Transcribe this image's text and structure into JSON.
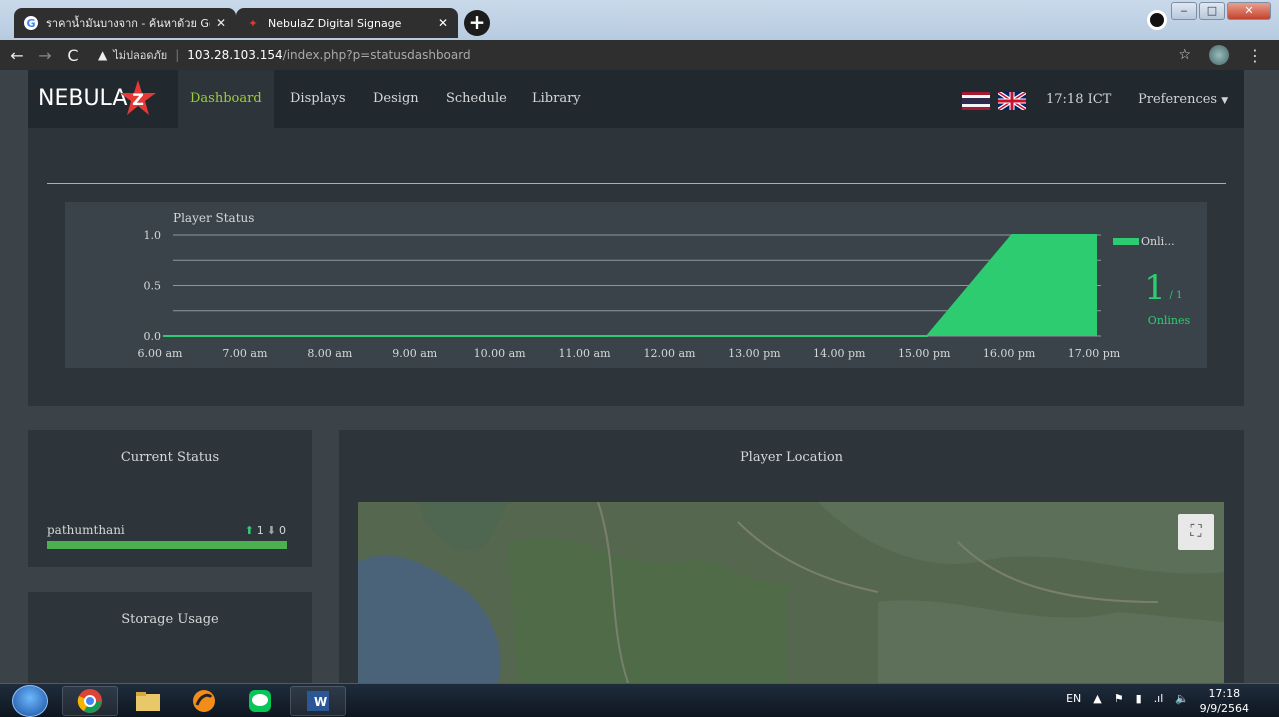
{
  "browser": {
    "tabs": [
      {
        "label": "ราคาน้ำมันบางจาก - ค้นหาด้วย Googl",
        "icon": "google-icon",
        "active": false
      },
      {
        "label": "NebulaZ Digital Signage",
        "icon": "nebulaz-icon",
        "active": true
      }
    ],
    "address": {
      "insecure_label": "ไม่ปลอดภัย",
      "host": "103.28.103.154",
      "path": "/index.php?p=statusdashboard"
    }
  },
  "app": {
    "logo": "NEBULA",
    "nav": [
      {
        "label": "Dashboard",
        "active": true
      },
      {
        "label": "Displays",
        "active": false
      },
      {
        "label": "Design",
        "active": false
      },
      {
        "label": "Schedule",
        "active": false
      },
      {
        "label": "Library",
        "active": false
      }
    ],
    "clock": "17:18 ICT",
    "preferences": "Preferences"
  },
  "chart_data": {
    "type": "area",
    "title": "Player Status",
    "categories": [
      "6.00 am",
      "7.00 am",
      "8.00 am",
      "9.00 am",
      "10.00 am",
      "11.00 am",
      "12.00 am",
      "13.00 pm",
      "14.00 pm",
      "15.00 pm",
      "16.00 pm",
      "17.00 pm"
    ],
    "y_ticks": [
      "1.0",
      "0.5",
      "0.0"
    ],
    "ylim": [
      0,
      1
    ],
    "series": [
      {
        "name": "Onli...",
        "color": "#2ecc71",
        "points": [
          [
            0,
            0
          ],
          [
            1,
            0
          ],
          [
            2,
            0
          ],
          [
            3,
            0
          ],
          [
            4,
            0
          ],
          [
            5,
            0
          ],
          [
            6,
            0
          ],
          [
            7,
            0
          ],
          [
            8,
            0
          ],
          [
            9,
            0
          ],
          [
            10,
            1
          ],
          [
            11,
            1
          ]
        ]
      }
    ],
    "legend": "top-right",
    "grid": true
  },
  "online_summary": {
    "count": "1",
    "total": "/ 1",
    "label": "Onlines"
  },
  "current_status": {
    "title": "Current Status",
    "rows": [
      {
        "name": "pathumthani",
        "up": "1",
        "down": "0"
      }
    ]
  },
  "storage": {
    "title": "Storage Usage"
  },
  "location": {
    "title": "Player Location"
  },
  "taskbar": {
    "lang": "EN",
    "time": "17:18",
    "date": "9/9/2564"
  },
  "colors": {
    "accent": "#9ccd3b",
    "online": "#2ecc71",
    "bar": "#4caf50"
  }
}
